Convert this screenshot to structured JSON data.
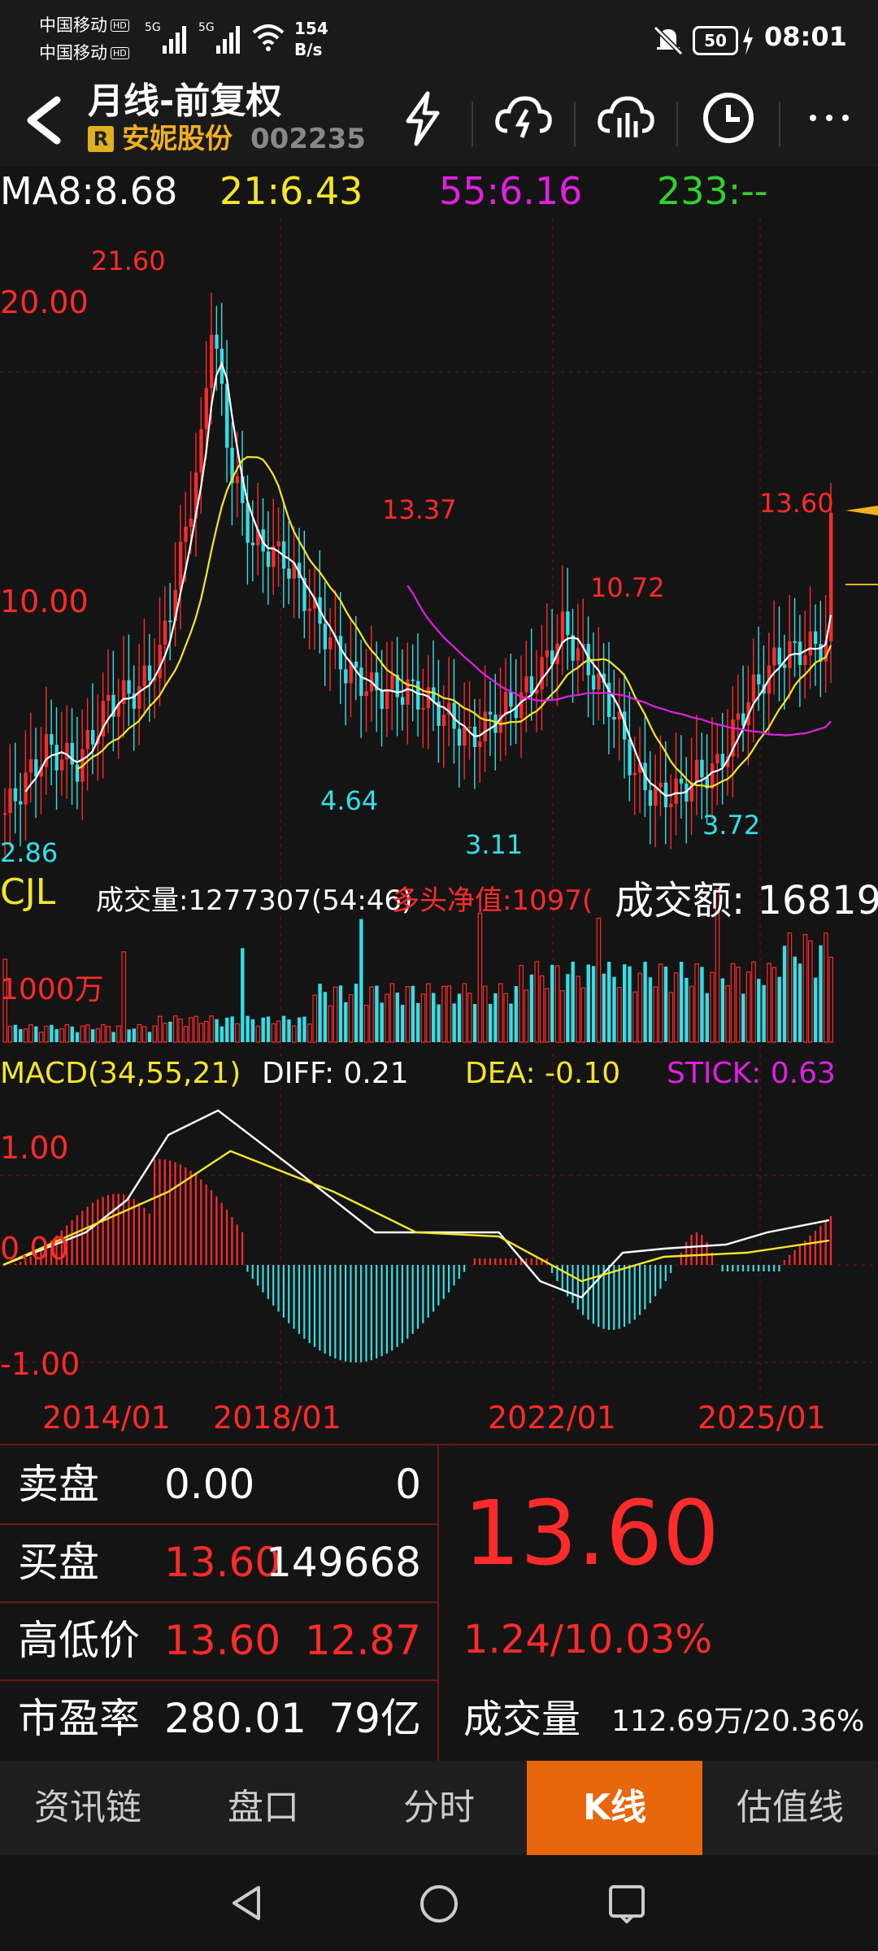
{
  "status": {
    "carrier1": "中国移动",
    "carrier2": "中国移动",
    "hd": "HD",
    "net": "5G",
    "speed_top": "154",
    "speed_bottom": "B/s",
    "battery": "50",
    "time": "08:01"
  },
  "header": {
    "title": "月线-前复权",
    "badge": "R",
    "stock_name": "安妮股份",
    "stock_code": "002235",
    "icons": [
      "back-icon",
      "lightning-icon",
      "cloud-lightning-icon",
      "cloud-chart-icon",
      "clock-icon",
      "more-icon"
    ]
  },
  "ma": {
    "ma8": "MA8:8.68",
    "ma21": "21:6.43",
    "ma55": "55:6.16",
    "ma233": "233:--"
  },
  "kline_labels": {
    "y_top": "20.00",
    "y_mid": "10.00",
    "high_label": "21.60",
    "peak2": "13.37",
    "peak3": "10.72",
    "current_high": "13.60",
    "low1": "2.86",
    "low2": "4.64",
    "low3": "3.11",
    "low4": "3.72"
  },
  "volume_labels": {
    "title": "CJL",
    "volume": "成交量:1277307(54:46)",
    "net": "多头净值:1097(",
    "amount": "成交额: 16819",
    "scale": "1000万"
  },
  "macd_labels": {
    "title": "MACD(34,55,21)",
    "diff": "DIFF: 0.21",
    "dea": "DEA: -0.10",
    "stick": "STICK: 0.63",
    "y_top": "1.00",
    "y_zero": "0.00",
    "y_bottom": "-1.00"
  },
  "xaxis": [
    "2014/01",
    "2018/01",
    "2022/01",
    "2025/01"
  ],
  "quotes": {
    "sell_label": "卖盘",
    "sell_price": "0.00",
    "sell_vol": "0",
    "buy_label": "买盘",
    "buy_price": "13.60",
    "buy_vol": "149668",
    "hl_label": "高低价",
    "high": "13.60",
    "low": "12.87",
    "pe_label": "市盈率",
    "pe": "280.01",
    "mcap": "79亿",
    "price": "13.60",
    "change": "1.24/10.03%",
    "vol_label": "成交量",
    "vol_value": "112.69万/20.36%"
  },
  "tabs": [
    "资讯链",
    "盘口",
    "分时",
    "K线",
    "估值线"
  ],
  "colors": {
    "up": "#ff2a2a",
    "down": "#30e0e8",
    "ma21": "#f5e626",
    "ma55": "#e020e0",
    "active_tab": "#e8660c"
  }
}
